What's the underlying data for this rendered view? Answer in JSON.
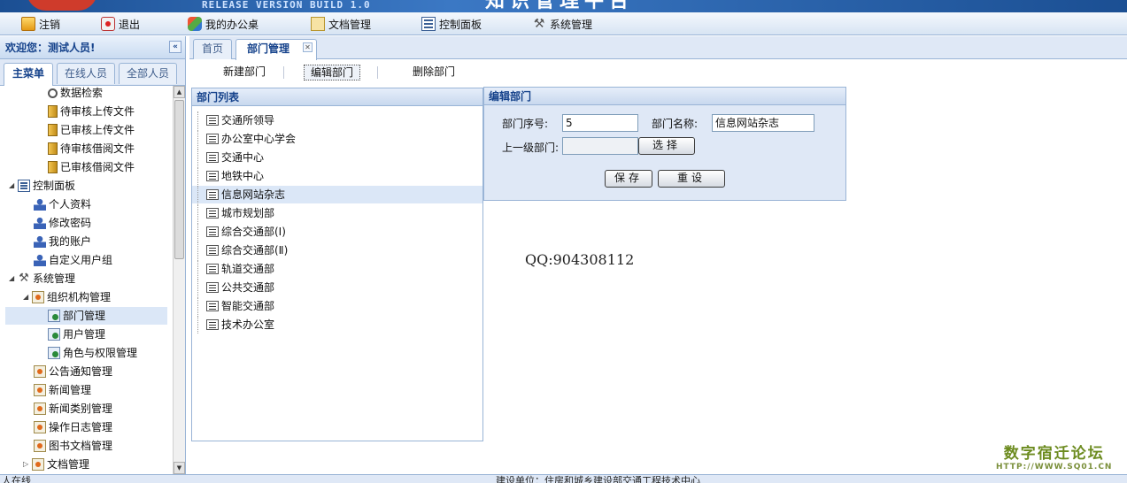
{
  "banner": {
    "release": "RELEASE VERSION BUILD 1.0",
    "title": "知识管理平台"
  },
  "menu": [
    {
      "label": "注销",
      "icon": "logout-icon"
    },
    {
      "label": "退出",
      "icon": "exit-icon"
    },
    {
      "label": "我的办公桌",
      "icon": "desk-icon"
    },
    {
      "label": "文档管理",
      "icon": "document-icon"
    },
    {
      "label": "控制面板",
      "icon": "control-panel-icon"
    },
    {
      "label": "系统管理",
      "icon": "tools-icon"
    }
  ],
  "left": {
    "welcome": "欢迎您：测试人员!",
    "tabs": [
      "主菜单",
      "在线人员",
      "全部人员"
    ],
    "tree": [
      {
        "label": "数据检索",
        "icon": "search-icon"
      },
      {
        "label": "待审核上传文件",
        "icon": "file-icon"
      },
      {
        "label": "已审核上传文件",
        "icon": "file-icon"
      },
      {
        "label": "待审核借阅文件",
        "icon": "file-icon"
      },
      {
        "label": "已审核借阅文件",
        "icon": "file-icon"
      },
      {
        "label": "控制面板",
        "icon": "control-panel-icon"
      },
      {
        "label": "个人资料",
        "icon": "user-icon"
      },
      {
        "label": "修改密码",
        "icon": "user-icon"
      },
      {
        "label": "我的账户",
        "icon": "user-icon"
      },
      {
        "label": "自定义用户组",
        "icon": "user-icon"
      },
      {
        "label": "系统管理",
        "icon": "tools-icon"
      },
      {
        "label": "组织机构管理",
        "icon": "org-icon"
      },
      {
        "label": "部门管理",
        "icon": "module-icon"
      },
      {
        "label": "用户管理",
        "icon": "module-icon"
      },
      {
        "label": "角色与权限管理",
        "icon": "module-icon"
      },
      {
        "label": "公告通知管理",
        "icon": "org-icon"
      },
      {
        "label": "新闻管理",
        "icon": "org-icon"
      },
      {
        "label": "新闻类别管理",
        "icon": "org-icon"
      },
      {
        "label": "操作日志管理",
        "icon": "org-icon"
      },
      {
        "label": "图书文档管理",
        "icon": "org-icon"
      },
      {
        "label": "文档管理",
        "icon": "org-icon"
      }
    ]
  },
  "main": {
    "tabs": [
      "首页",
      "部门管理"
    ],
    "toolbar": [
      "新建部门",
      "编辑部门",
      "删除部门"
    ],
    "list_title": "部门列表",
    "departments": [
      "交通所领导",
      "办公室中心学会",
      "交通中心",
      "地铁中心",
      "信息网站杂志",
      "城市规划部",
      "综合交通部(Ⅰ)",
      "综合交通部(Ⅱ)",
      "轨道交通部",
      "公共交通部",
      "智能交通部",
      "技术办公室"
    ],
    "selected_department": "信息网站杂志",
    "edit": {
      "title": "编辑部门",
      "seq_label": "部门序号:",
      "seq_value": "5",
      "name_label": "部门名称:",
      "name_value": "信息网站杂志",
      "parent_label": "上一级部门:",
      "parent_value": "",
      "choose_button": "选择",
      "save_button": "保存",
      "reset_button": "重设"
    },
    "qq": "QQ:904308112"
  },
  "watermark": {
    "line1": "数字宿迁论坛",
    "line2": "HTTP://WWW.SQ01.CN"
  },
  "status": {
    "online": "人在线",
    "builder": "建设单位：住房和城乡建设部交通工程技术中心"
  },
  "colors": {
    "accent": "#15428b",
    "border": "#99b4d6",
    "header_bg": "#dfe8f6",
    "selected_bg": "#dbe7f7"
  }
}
